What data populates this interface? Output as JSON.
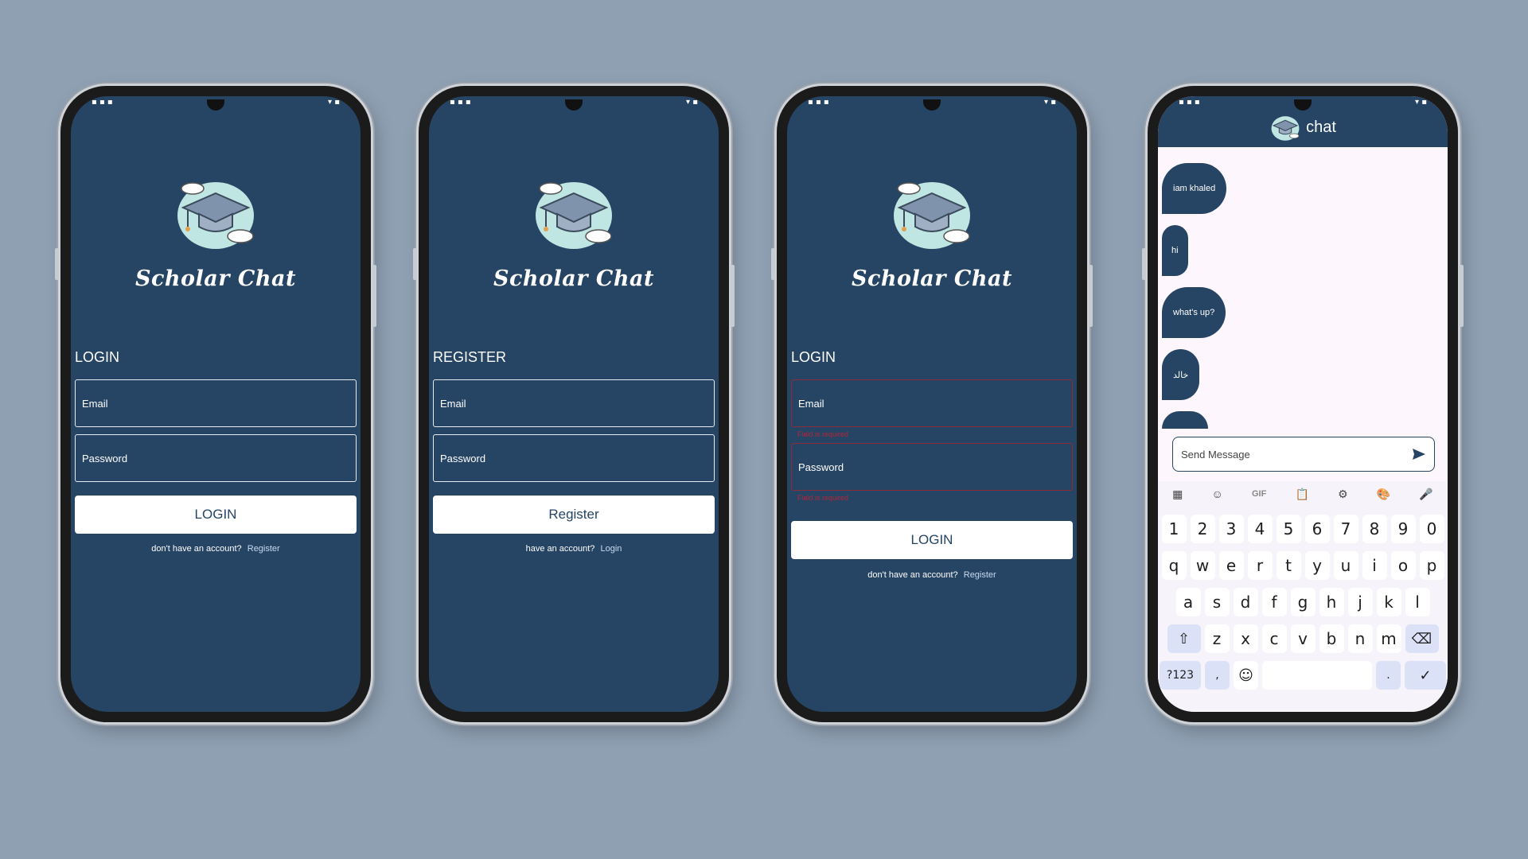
{
  "app": {
    "name": "Scholar Chat"
  },
  "login": {
    "heading": "LOGIN",
    "email_label": "Email",
    "password_label": "Password",
    "button_label": "LOGIN",
    "prompt": "don't have an account?",
    "link": "Register"
  },
  "register": {
    "heading": "REGISTER",
    "email_label": "Email",
    "password_label": "Password",
    "button_label": "Register",
    "prompt": "have an account?",
    "link": "Login"
  },
  "login_error": {
    "heading": "LOGIN",
    "email_label": "Email",
    "password_label": "Password",
    "error_message": "Field is required",
    "button_label": "LOGIN",
    "prompt": "don't have an account?",
    "link": "Register"
  },
  "chat": {
    "title": "chat",
    "messages": [
      "iam khaled",
      "hi",
      "what's up?",
      "خالد"
    ],
    "input_placeholder": "Send Message"
  },
  "keyboard": {
    "tools": [
      "▦",
      "☺",
      "GIF",
      "📋",
      "⚙",
      "🎨",
      "🎤"
    ],
    "row_numbers": [
      "1",
      "2",
      "3",
      "4",
      "5",
      "6",
      "7",
      "8",
      "9",
      "0"
    ],
    "row_1": [
      "q",
      "w",
      "e",
      "r",
      "t",
      "y",
      "u",
      "i",
      "o",
      "p"
    ],
    "row_2": [
      "a",
      "s",
      "d",
      "f",
      "g",
      "h",
      "j",
      "k",
      "l"
    ],
    "row_3": [
      "z",
      "x",
      "c",
      "v",
      "b",
      "n",
      "m"
    ],
    "shift": "⇧",
    "backspace": "⌫",
    "symbols": "?123",
    "comma": ",",
    "emoji": "☺",
    "period": ".",
    "enter": "✓"
  },
  "colors": {
    "background": "#8fa0b3",
    "primary": "#264463",
    "error": "#b3263c"
  }
}
